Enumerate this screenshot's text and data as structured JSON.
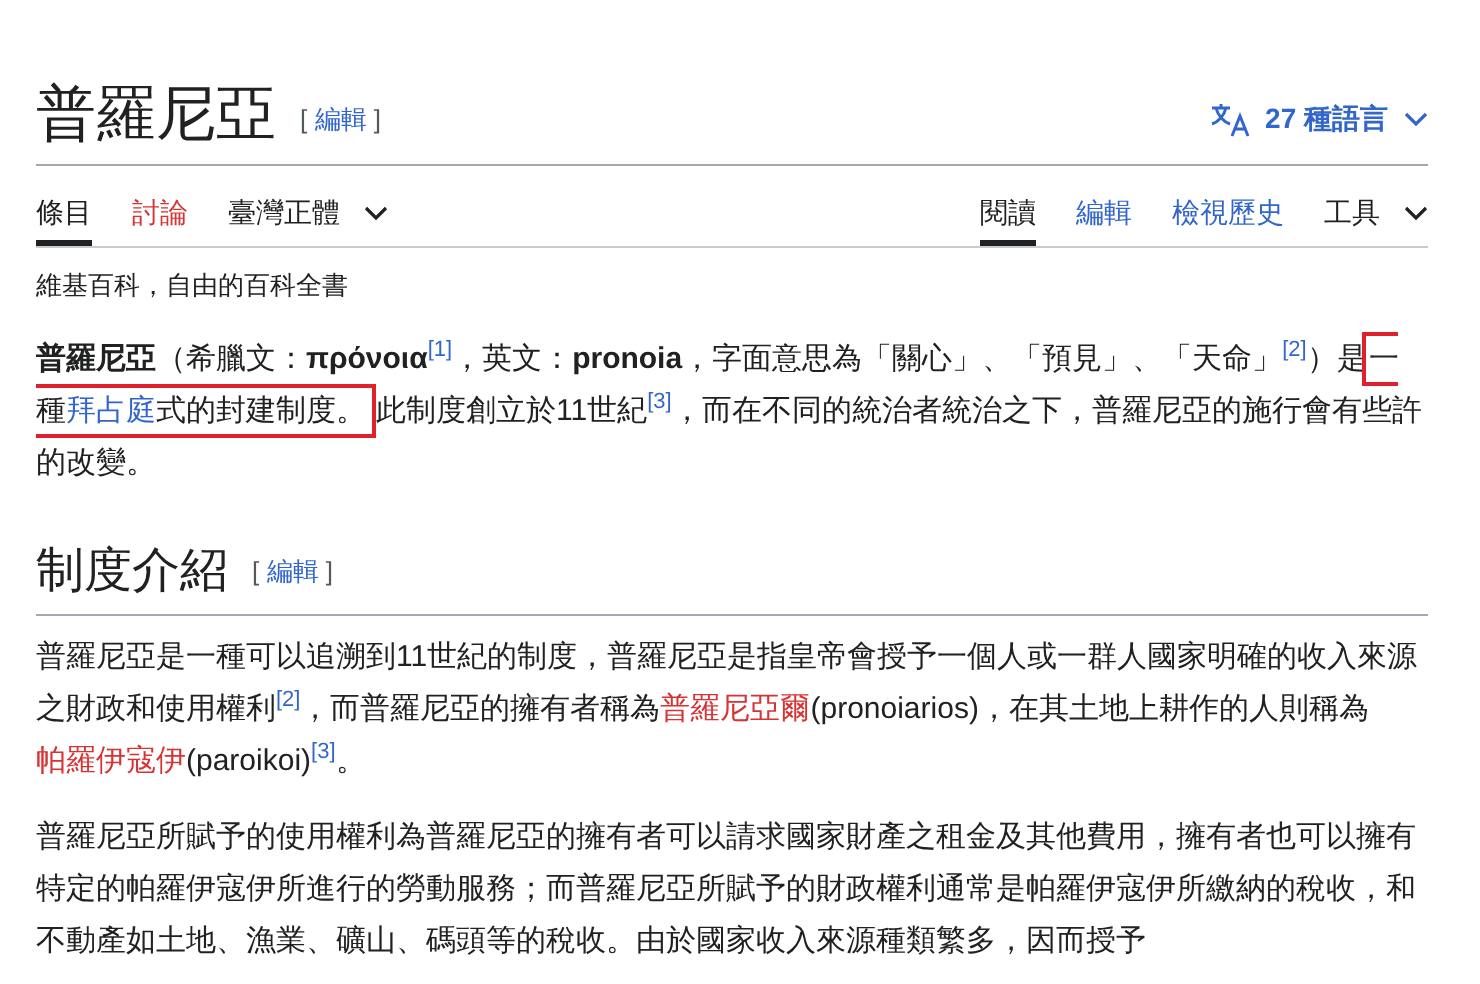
{
  "title": "普羅尼亞",
  "title_edit": {
    "open": "[",
    "label": "編輯",
    "close": "]"
  },
  "languages": "27 種語言",
  "left_tabs": [
    {
      "label": "條目",
      "selected": true,
      "kind": "tab"
    },
    {
      "label": "討論",
      "selected": false,
      "kind": "redtab"
    },
    {
      "label": "臺灣正體",
      "selected": false,
      "kind": "dropdown"
    }
  ],
  "right_tabs": [
    {
      "label": "閱讀",
      "selected": true,
      "kind": "tab"
    },
    {
      "label": "編輯",
      "selected": false,
      "kind": "tab"
    },
    {
      "label": "檢視歷史",
      "selected": false,
      "kind": "tab"
    },
    {
      "label": "工具",
      "selected": false,
      "kind": "dropdown"
    }
  ],
  "tagline": "維基百科，自由的百科全書",
  "lead": [
    {
      "kind": "bold",
      "text": "普羅尼亞"
    },
    {
      "kind": "text",
      "text": "（希臘文："
    },
    {
      "kind": "bold",
      "text": "πρόνοια"
    },
    {
      "kind": "ref",
      "text": "[1]"
    },
    {
      "kind": "text",
      "text": "，英文："
    },
    {
      "kind": "bold",
      "text": "pronoia"
    },
    {
      "kind": "text",
      "text": "，字面意思為「關心」、「預見」、「天命」"
    },
    {
      "kind": "ref",
      "text": "[2]"
    },
    {
      "kind": "text",
      "text": "）是"
    },
    {
      "kind": "box",
      "children": [
        {
          "kind": "text",
          "text": "一種"
        },
        {
          "kind": "link",
          "text": "拜占庭"
        },
        {
          "kind": "text",
          "text": "式的封建制度。"
        }
      ]
    },
    {
      "kind": "text",
      "text": "此制度創立於11世紀"
    },
    {
      "kind": "ref",
      "text": "[3]"
    },
    {
      "kind": "text",
      "text": "，而在不同的統治者統治之下，普羅尼亞的施行會有些許的改變。"
    }
  ],
  "section": {
    "title": "制度介紹",
    "edit": {
      "open": "[",
      "label": "編輯",
      "close": "]"
    },
    "paragraphs": [
      [
        {
          "kind": "text",
          "text": "普羅尼亞是一種可以追溯到11世紀的制度，普羅尼亞是指皇帝會授予一個人或一群人國家明確的收入來源之財政和使用權利"
        },
        {
          "kind": "ref",
          "text": "[2]"
        },
        {
          "kind": "text",
          "text": "，而普羅尼亞的擁有者稱為"
        },
        {
          "kind": "redlink",
          "text": "普羅尼亞爾"
        },
        {
          "kind": "text",
          "text": "(pronoiarios)，在其土地上耕作的人則稱為"
        },
        {
          "kind": "redlink",
          "text": "帕羅伊寇伊"
        },
        {
          "kind": "text",
          "text": "(paroikoi)"
        },
        {
          "kind": "ref",
          "text": "[3]"
        },
        {
          "kind": "text",
          "text": "。"
        }
      ],
      [
        {
          "kind": "text",
          "text": "普羅尼亞所賦予的使用權利為普羅尼亞的擁有者可以請求國家財產之租金及其他費用，擁有者也可以擁有特定的帕羅伊寇伊所進行的勞動服務；而普羅尼亞所賦予的財政權利通常是帕羅伊寇伊所繳納的稅收，和不動產如土地、漁業、礦山、碼頭等的稅收。由於國家收入來源種類繁多，因而授予"
        }
      ]
    ]
  }
}
